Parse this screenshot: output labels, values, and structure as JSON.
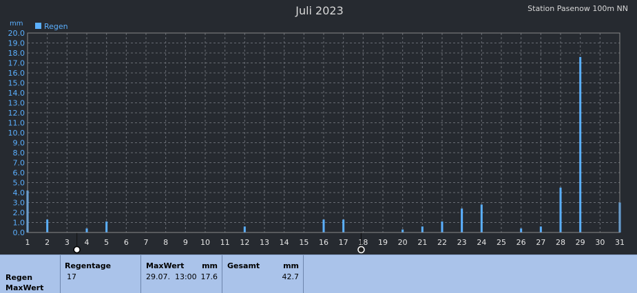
{
  "header": {
    "title": "Juli 2023",
    "station": "Station Pasenow 100m NN"
  },
  "chart_data": {
    "type": "bar",
    "title": "Juli 2023",
    "ylabel": "mm",
    "ylim": [
      0,
      20
    ],
    "y_ticks": [
      "0.0",
      "1.0",
      "2.0",
      "3.0",
      "4.0",
      "5.0",
      "6.0",
      "7.0",
      "8.0",
      "9.0",
      "10.0",
      "11.0",
      "12.0",
      "13.0",
      "14.0",
      "15.0",
      "16.0",
      "17.0",
      "18.0",
      "19.0",
      "20.0"
    ],
    "x_ticks": [
      "1",
      "2",
      "3",
      "4",
      "5",
      "6",
      "7",
      "8",
      "9",
      "10",
      "11",
      "12",
      "13",
      "14",
      "15",
      "16",
      "17",
      "18",
      "19",
      "20",
      "21",
      "22",
      "23",
      "24",
      "25",
      "26",
      "27",
      "28",
      "29",
      "30",
      "31"
    ],
    "grid": true,
    "legend_position": "top-left",
    "series": [
      {
        "name": "Regen",
        "color": "#5bb0ff",
        "points": [
          {
            "x": 1.0,
            "y": 4.2
          },
          {
            "x": 2.0,
            "y": 1.3
          },
          {
            "x": 4.0,
            "y": 0.4
          },
          {
            "x": 5.0,
            "y": 1.1
          },
          {
            "x": 12.0,
            "y": 0.6
          },
          {
            "x": 16.0,
            "y": 1.3
          },
          {
            "x": 17.0,
            "y": 1.3
          },
          {
            "x": 20.0,
            "y": 0.3
          },
          {
            "x": 21.0,
            "y": 0.6
          },
          {
            "x": 22.0,
            "y": 1.1
          },
          {
            "x": 23.0,
            "y": 2.4
          },
          {
            "x": 24.0,
            "y": 2.8
          },
          {
            "x": 26.0,
            "y": 0.4
          },
          {
            "x": 27.0,
            "y": 0.6
          },
          {
            "x": 28.0,
            "y": 4.5
          },
          {
            "x": 29.0,
            "y": 17.6
          },
          {
            "x": 31.0,
            "y": 3.0
          }
        ]
      }
    ],
    "moon_markers": [
      {
        "x": 3.5,
        "icon": "full-moon-icon"
      },
      {
        "x": 17.9,
        "icon": "new-moon-icon"
      }
    ]
  },
  "stats": {
    "row_label_1": "Regen",
    "row_label_2": "MaxWert",
    "regentage_label": "Regentage",
    "regentage_value": "17",
    "maxwert_label": "MaxWert",
    "maxwert_unit": "mm",
    "maxwert_date": "29.07.  13:00",
    "maxwert_value": "17.6",
    "gesamt_label": "Gesamt",
    "gesamt_unit": "mm",
    "gesamt_value": "42.7"
  }
}
